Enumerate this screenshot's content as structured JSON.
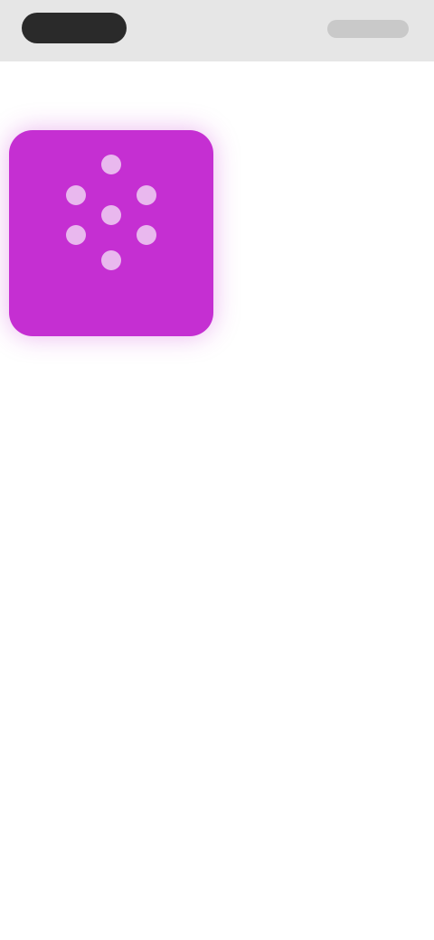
{
  "status_bar": {},
  "nav": {
    "back_label": "",
    "title": "",
    "action_label": ""
  },
  "tile": {
    "label": "",
    "icon": "dotted-circle-icon",
    "background_color": "#c52fd2",
    "icon_color": "#e9b8ee"
  },
  "colors": {
    "status_bar": "#e6e6e6",
    "accent": "#e7b3ec",
    "background": "#ffffff"
  }
}
